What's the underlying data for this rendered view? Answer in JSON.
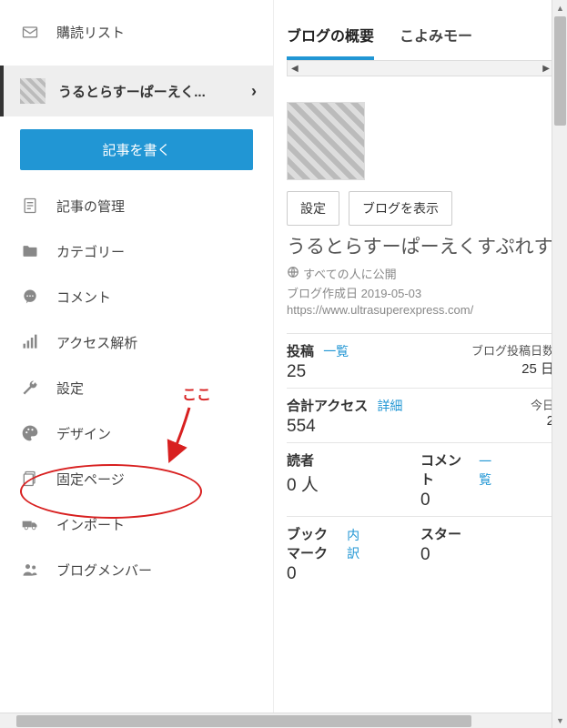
{
  "sidebar": {
    "reading_list": "購読リスト",
    "blog_title": "うるとらすーぱーえく...",
    "write_post": "記事を書く",
    "items": [
      {
        "label": "記事の管理"
      },
      {
        "label": "カテゴリー"
      },
      {
        "label": "コメント"
      },
      {
        "label": "アクセス解析"
      },
      {
        "label": "設定"
      },
      {
        "label": "デザイン"
      },
      {
        "label": "固定ページ"
      },
      {
        "label": "インポート"
      },
      {
        "label": "ブログメンバー"
      }
    ]
  },
  "main": {
    "tabs": {
      "overview": "ブログの概要",
      "calendar": "こよみモー"
    },
    "settings_btn": "設定",
    "view_blog_btn": "ブログを表示",
    "blog_name": "うるとらすーぱーえくすぷれす",
    "visibility": "すべての人に公開",
    "created_label": "ブログ作成日 2019-05-03",
    "url": "https://www.ultrasuperexpress.com/",
    "stats": {
      "posts_label": "投稿",
      "posts_link": "一覧",
      "posts_val": "25",
      "post_days_label": "ブログ投稿日数",
      "post_days_val": "25 日",
      "total_access_label": "合計アクセス",
      "total_access_link": "詳細",
      "total_access_val": "554",
      "today_label": "今日",
      "today_val": "2",
      "readers_label": "読者",
      "readers_val": "0 人",
      "comments_label": "コメント",
      "comments_link": "一覧",
      "comments_val": "0",
      "bookmarks_label": "ブックマーク",
      "bookmarks_link": "内訳",
      "bookmarks_val": "0",
      "stars_label": "スター",
      "stars_val": "0"
    }
  },
  "annotation": {
    "here": "ここ"
  }
}
